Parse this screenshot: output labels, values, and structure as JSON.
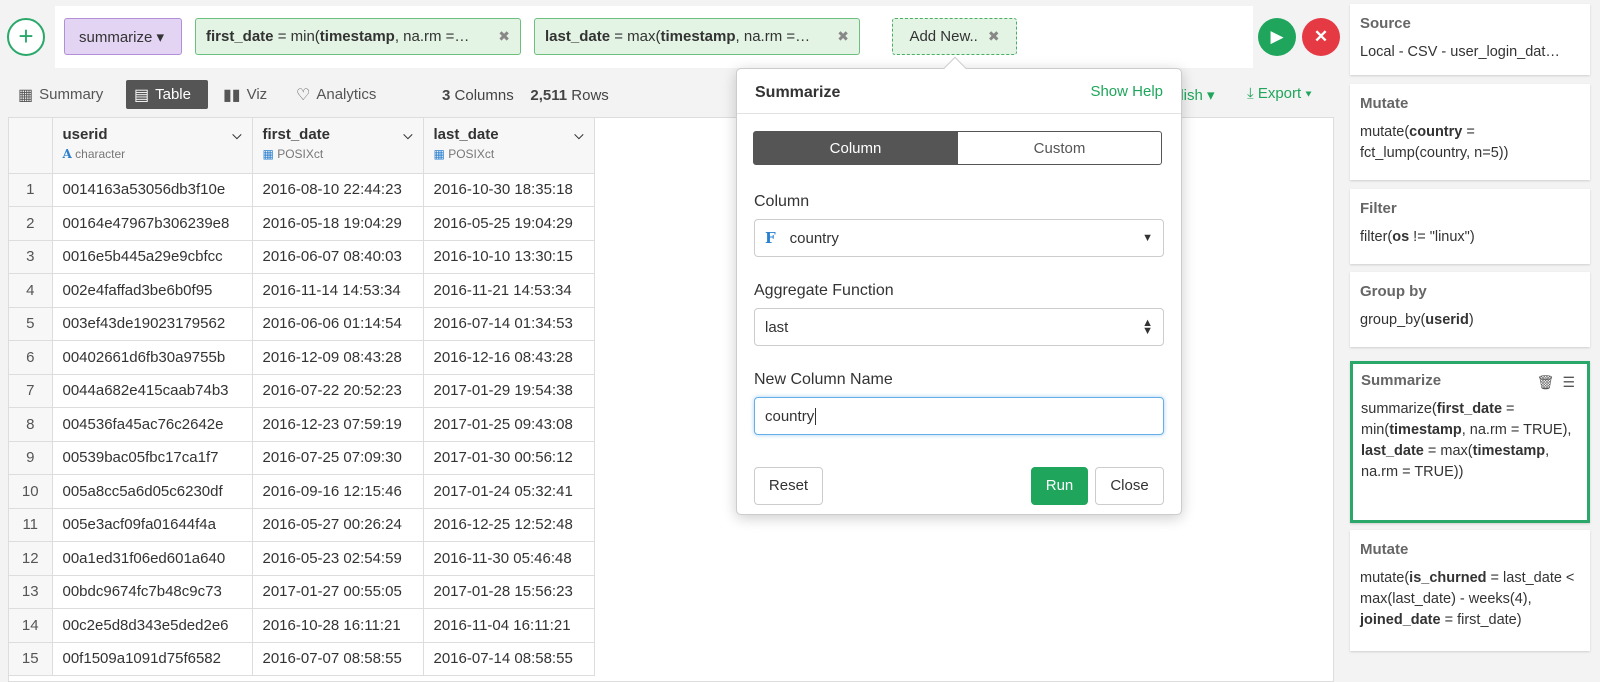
{
  "command_bar": {
    "add_icon": "plus-icon",
    "command": "summarize ▾",
    "args": [
      {
        "name": "first_date",
        "eq": " = min(",
        "bold": "timestamp",
        "rest": ", na.rm =…"
      },
      {
        "name": "last_date",
        "eq": " = max(",
        "bold": "timestamp",
        "rest": ", na.rm =…"
      }
    ],
    "add_new": "Add New..",
    "close_glyph": "✖",
    "run_icon": "play-icon",
    "cancel_icon": "close-icon"
  },
  "view_tabs": [
    {
      "label": "Summary",
      "icon": "summary-icon",
      "glyph": "▦"
    },
    {
      "label": "Table",
      "icon": "table-icon",
      "glyph": "▤",
      "active": true
    },
    {
      "label": "Viz",
      "icon": "bar-chart-icon",
      "glyph": "▮▮"
    },
    {
      "label": "Analytics",
      "icon": "bulb-icon",
      "glyph": "♡"
    }
  ],
  "counts": {
    "columns": "3",
    "columns_label": "Columns",
    "rows": "2,511",
    "rows_label": "Rows"
  },
  "toolbar": {
    "publish": "blish ▾",
    "export": "Export ▾",
    "export_glyph": "⤓"
  },
  "table": {
    "columns": [
      {
        "name": "userid",
        "type": "character",
        "type_glyph": "A"
      },
      {
        "name": "first_date",
        "type": "POSIXct",
        "type_glyph": "▦"
      },
      {
        "name": "last_date",
        "type": "POSIXct",
        "type_glyph": "▦"
      }
    ],
    "rows": [
      [
        "1",
        "0014163a53056db3f10e",
        "2016-08-10 22:44:23",
        "2016-10-30 18:35:18"
      ],
      [
        "2",
        "00164e47967b306239e8",
        "2016-05-18 19:04:29",
        "2016-05-25 19:04:29"
      ],
      [
        "3",
        "0016e5b445a29e9cbfcc",
        "2016-06-07 08:40:03",
        "2016-10-10 13:30:15"
      ],
      [
        "4",
        "002e4faffad3be6b0f95",
        "2016-11-14 14:53:34",
        "2016-11-21 14:53:34"
      ],
      [
        "5",
        "003ef43de19023179562",
        "2016-06-06 01:14:54",
        "2016-07-14 01:34:53"
      ],
      [
        "6",
        "00402661d6fb30a9755b",
        "2016-12-09 08:43:28",
        "2016-12-16 08:43:28"
      ],
      [
        "7",
        "0044a682e415caab74b3",
        "2016-07-22 20:52:23",
        "2017-01-29 19:54:38"
      ],
      [
        "8",
        "004536fa45ac76c2642e",
        "2016-12-23 07:59:19",
        "2017-01-25 09:43:08"
      ],
      [
        "9",
        "00539bac05fbc17ca1f7",
        "2016-07-25 07:09:30",
        "2017-01-30 00:56:12"
      ],
      [
        "10",
        "005a8cc5a6d05c6230df",
        "2016-09-16 12:15:46",
        "2017-01-24 05:32:41"
      ],
      [
        "11",
        "005e3acf09fa01644f4a",
        "2016-05-27 00:26:24",
        "2016-12-25 12:52:48"
      ],
      [
        "12",
        "00a1ed31f06ed601a640",
        "2016-05-23 02:54:59",
        "2016-11-30 05:46:48"
      ],
      [
        "13",
        "00bdc9674fc7b48c9c73",
        "2017-01-27 00:55:05",
        "2017-01-28 15:56:23"
      ],
      [
        "14",
        "00c2e5d8d343e5ded2e6",
        "2016-10-28 16:11:21",
        "2016-11-04 16:11:21"
      ],
      [
        "15",
        "00f1509a1091d75f6582",
        "2016-07-07 08:58:55",
        "2016-07-14 08:58:55"
      ]
    ]
  },
  "popup": {
    "title": "Summarize",
    "help": "Show Help",
    "tabs": {
      "column": "Column",
      "custom": "Custom"
    },
    "column_label": "Column",
    "column_type_glyph": "F",
    "column_value": "country",
    "agg_label": "Aggregate Function",
    "agg_value": "last",
    "name_label": "New Column Name",
    "name_value": "country",
    "reset": "Reset",
    "run": "Run",
    "close": "Close"
  },
  "steps": [
    {
      "title": "Source",
      "body_plain": "Local - CSV - user_login_dat…"
    },
    {
      "title": "Mutate",
      "body_html": "mutate(<b>country</b> = fct_lump(country, n=5))"
    },
    {
      "title": "Filter",
      "body_html": "filter(<b>os</b> != \"linux\")"
    },
    {
      "title": "Group by",
      "body_html": "group_by(<b>userid</b>)"
    },
    {
      "title": "Summarize",
      "active": true,
      "body_html": "summarize(<b>first_date</b> = min(<b>timestamp</b>, na.rm = TRUE), <b>last_date</b> = max(<b>timestamp</b>, na.rm = TRUE))"
    },
    {
      "title": "Mutate",
      "body_html": "mutate(<b>is_churned</b> = last_date &lt; max(last_date) - weeks(4), <b>joined_date</b> = first_date)"
    }
  ],
  "colors": {
    "accent": "#1fa65c",
    "cancel": "#e53a44",
    "command_token": "#e4d4f4",
    "arg_token": "#e3f4e4"
  }
}
